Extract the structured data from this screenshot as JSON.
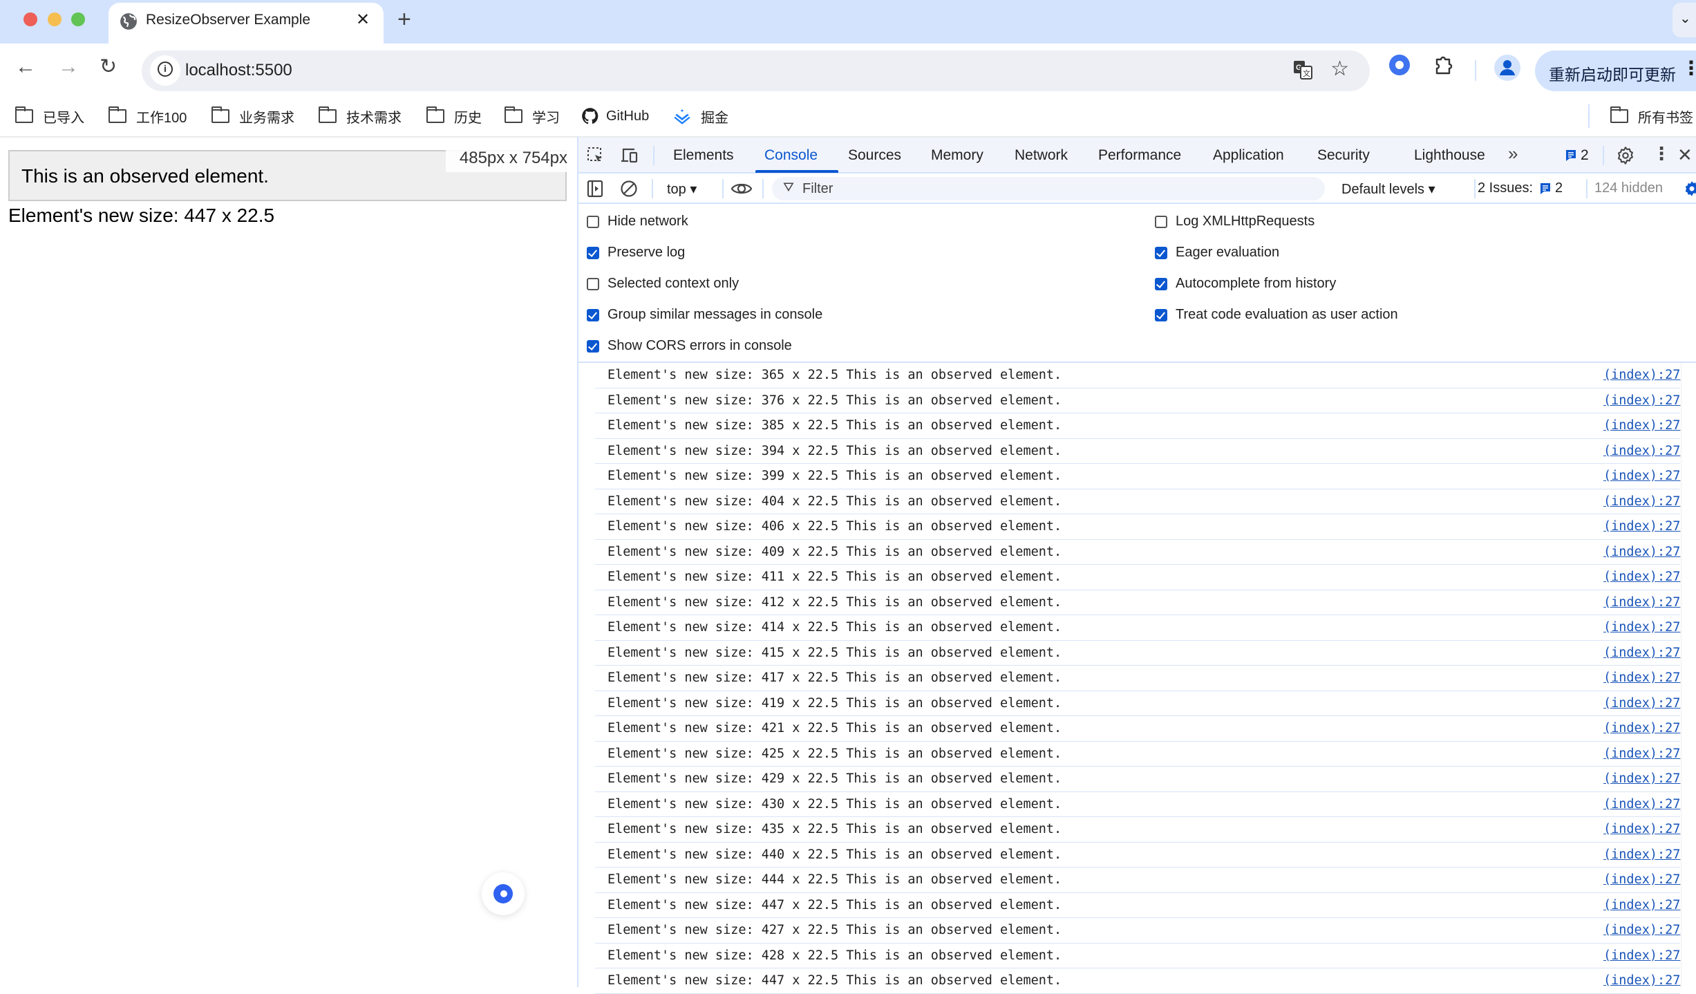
{
  "window": {
    "traffic_lights": {
      "close": "#ee5f57",
      "minimize": "#f6be4f",
      "maximize": "#61c454"
    }
  },
  "tabs": [
    {
      "title": "ResizeObserver Example",
      "favicon": "globe-icon",
      "active": true
    }
  ],
  "tabstrip": {
    "new_tab": "+",
    "close": "✕",
    "tab_search": "⌄"
  },
  "toolbar": {
    "back": "←",
    "forward": "→",
    "reload": "↻",
    "url": "localhost:5500",
    "site_info": "i",
    "bookmark_star": "☆",
    "update_button": "重新启动即可更新",
    "menu": "⋮"
  },
  "bookmarks": {
    "items": [
      {
        "label": "已导入",
        "icon": "folder-icon"
      },
      {
        "label": "工作100",
        "icon": "folder-icon"
      },
      {
        "label": "业务需求",
        "icon": "folder-icon"
      },
      {
        "label": "技术需求",
        "icon": "folder-icon"
      },
      {
        "label": "历史",
        "icon": "folder-icon"
      },
      {
        "label": "学习",
        "icon": "folder-icon"
      },
      {
        "label": "GitHub",
        "icon": "github-icon"
      },
      {
        "label": "掘金",
        "icon": "juejin-icon"
      }
    ],
    "all_bookmarks": "所有书签"
  },
  "page": {
    "observed_text": "This is an observed element.",
    "viewport_size": "485px x 754px",
    "new_size_text": "Element's new size: 447 x 22.5"
  },
  "devtools": {
    "tabs": [
      {
        "label": "Elements"
      },
      {
        "label": "Console",
        "active": true
      },
      {
        "label": "Sources"
      },
      {
        "label": "Memory"
      },
      {
        "label": "Network"
      },
      {
        "label": "Performance"
      },
      {
        "label": "Application"
      },
      {
        "label": "Security"
      },
      {
        "label": "Lighthouse"
      }
    ],
    "more_tabs": "»",
    "issues_badge_count": "2",
    "console_bar": {
      "context": "top ▾",
      "filter_placeholder": "Filter",
      "levels": "Default levels ▾",
      "issues_label": "2 Issues:",
      "issues_count": "2",
      "hidden": "124 hidden"
    },
    "settings_left": [
      {
        "label": "Hide network",
        "checked": false
      },
      {
        "label": "Preserve log",
        "checked": true
      },
      {
        "label": "Selected context only",
        "checked": false
      },
      {
        "label": "Group similar messages in console",
        "checked": true
      },
      {
        "label": "Show CORS errors in console",
        "checked": true
      }
    ],
    "settings_right": [
      {
        "label": "Log XMLHttpRequests",
        "checked": false
      },
      {
        "label": "Eager evaluation",
        "checked": true
      },
      {
        "label": "Autocomplete from history",
        "checked": true
      },
      {
        "label": "Treat code evaluation as user action",
        "checked": true
      }
    ],
    "messages": [
      {
        "text": "Element's new size: 365 x 22.5 This is an observed element.",
        "source": "(index):27"
      },
      {
        "text": "Element's new size: 376 x 22.5 This is an observed element.",
        "source": "(index):27"
      },
      {
        "text": "Element's new size: 385 x 22.5 This is an observed element.",
        "source": "(index):27"
      },
      {
        "text": "Element's new size: 394 x 22.5 This is an observed element.",
        "source": "(index):27"
      },
      {
        "text": "Element's new size: 399 x 22.5 This is an observed element.",
        "source": "(index):27"
      },
      {
        "text": "Element's new size: 404 x 22.5 This is an observed element.",
        "source": "(index):27"
      },
      {
        "text": "Element's new size: 406 x 22.5 This is an observed element.",
        "source": "(index):27"
      },
      {
        "text": "Element's new size: 409 x 22.5 This is an observed element.",
        "source": "(index):27"
      },
      {
        "text": "Element's new size: 411 x 22.5 This is an observed element.",
        "source": "(index):27"
      },
      {
        "text": "Element's new size: 412 x 22.5 This is an observed element.",
        "source": "(index):27"
      },
      {
        "text": "Element's new size: 414 x 22.5 This is an observed element.",
        "source": "(index):27"
      },
      {
        "text": "Element's new size: 415 x 22.5 This is an observed element.",
        "source": "(index):27"
      },
      {
        "text": "Element's new size: 417 x 22.5 This is an observed element.",
        "source": "(index):27"
      },
      {
        "text": "Element's new size: 419 x 22.5 This is an observed element.",
        "source": "(index):27"
      },
      {
        "text": "Element's new size: 421 x 22.5 This is an observed element.",
        "source": "(index):27"
      },
      {
        "text": "Element's new size: 425 x 22.5 This is an observed element.",
        "source": "(index):27"
      },
      {
        "text": "Element's new size: 429 x 22.5 This is an observed element.",
        "source": "(index):27"
      },
      {
        "text": "Element's new size: 430 x 22.5 This is an observed element.",
        "source": "(index):27"
      },
      {
        "text": "Element's new size: 435 x 22.5 This is an observed element.",
        "source": "(index):27"
      },
      {
        "text": "Element's new size: 440 x 22.5 This is an observed element.",
        "source": "(index):27"
      },
      {
        "text": "Element's new size: 444 x 22.5 This is an observed element.",
        "source": "(index):27"
      },
      {
        "text": "Element's new size: 447 x 22.5 This is an observed element.",
        "source": "(index):27"
      },
      {
        "text": "Element's new size: 427 x 22.5 This is an observed element.",
        "source": "(index):27"
      },
      {
        "text": "Element's new size: 428 x 22.5 This is an observed element.",
        "source": "(index):27"
      },
      {
        "text": "Element's new size: 447 x 22.5 This is an observed element.",
        "source": "(index):27"
      }
    ]
  },
  "colors": {
    "tabstrip_bg": "#d3e3fd",
    "accent_blue": "#0b57d0",
    "link_blue": "#1a55b9",
    "observed_bg": "#efefef"
  }
}
